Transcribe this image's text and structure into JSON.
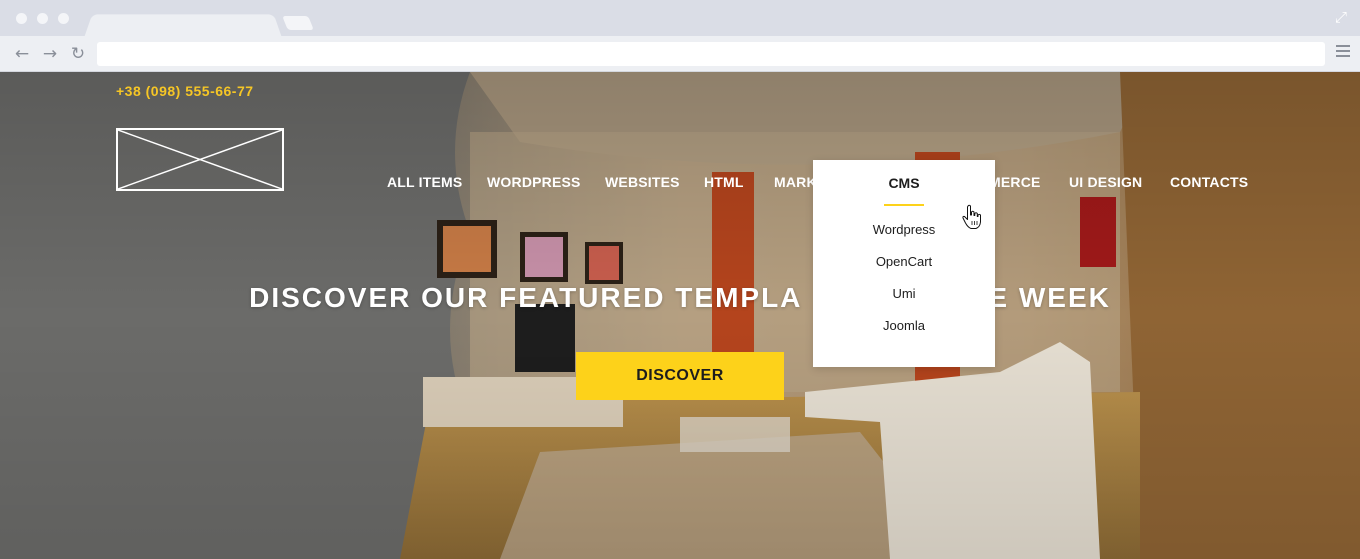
{
  "browser": {
    "address": ""
  },
  "page": {
    "phone": "+38 (098) 555-66-77",
    "nav": [
      "ALL ITEMS",
      "WORDPRESS",
      "WEBSITES",
      "HTML",
      "MARK",
      "MERCE",
      "UI DESIGN",
      "CONTACTS"
    ],
    "hero_title": "DISCOVER OUR FEATURED TEMPLA",
    "hero_title_tail": "E WEEK",
    "discover_label": "DISCOVER",
    "dropdown": {
      "title": "CMS",
      "items": [
        "Wordpress",
        "OpenCart",
        "Umi",
        "Joomla"
      ]
    }
  },
  "colors": {
    "accent": "#fdd21a",
    "phone": "#f6c625",
    "chrome": "#dadde6"
  },
  "icons": [
    "back-arrow-icon",
    "forward-arrow-icon",
    "reload-icon",
    "hamburger-menu-icon",
    "expand-icon",
    "hand-cursor-icon"
  ]
}
